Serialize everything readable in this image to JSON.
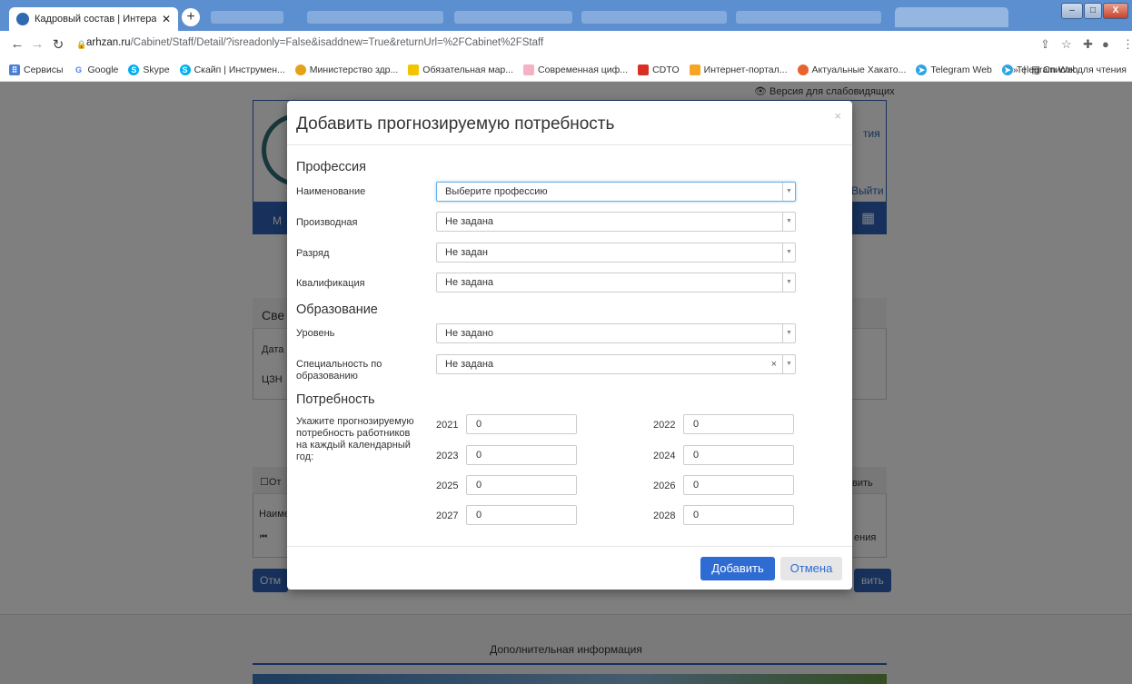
{
  "browser": {
    "active_tab": "Кадровый состав | Интерактив",
    "url_host": "arhzan.ru",
    "url_path": "/Cabinet/Staff/Detail/?isreadonly=False&isaddnew=True&returnUrl=%2FCabinet%2FStaff",
    "bookmarks": [
      "Сервисы",
      "Google",
      "Skype",
      "Скайп | Инструмен...",
      "Министерство здр...",
      "Обязательная мар...",
      "Современная циф...",
      "CDTO",
      "Интернет-портал...",
      "Актуальные Хакато...",
      "Telegram Web",
      "Telegram Web"
    ],
    "reading_list": "Список для чтения"
  },
  "page": {
    "accessibility": "Версия для слабовидящих",
    "frag_header_right": "тия",
    "frag_logout": "Выйти",
    "frag_nav_m": "М",
    "frag_sve": "Све",
    "frag_data": "Дата",
    "frag_czn": "ЦЗН",
    "frag_ot": "От",
    "frag_naim": "Наиме",
    "frag_btn1": "вить",
    "frag_btn2": "ения",
    "frag_otm": "Отм",
    "frag_btn3": "вить",
    "footer": "Дополнительная информация"
  },
  "modal": {
    "title": "Добавить прогнозируемую потребность",
    "close": "×",
    "profession": {
      "heading": "Профессия",
      "fields": [
        {
          "label": "Наименование",
          "value": "Выберите профессию"
        },
        {
          "label": "Производная",
          "value": "Не задана"
        },
        {
          "label": "Разряд",
          "value": "Не задан"
        },
        {
          "label": "Квалификация",
          "value": "Не задана"
        }
      ]
    },
    "education": {
      "heading": "Образование",
      "fields": [
        {
          "label": "Уровень",
          "value": "Не задано"
        },
        {
          "label": "Специальность по образованию",
          "value": "Не задана"
        }
      ]
    },
    "demand": {
      "heading": "Потребность",
      "hint": "Укажите прогнозируемую потребность работников на каждый календарный год:",
      "years": [
        {
          "year": "2021",
          "value": "0"
        },
        {
          "year": "2022",
          "value": "0"
        },
        {
          "year": "2023",
          "value": "0"
        },
        {
          "year": "2024",
          "value": "0"
        },
        {
          "year": "2025",
          "value": "0"
        },
        {
          "year": "2026",
          "value": "0"
        },
        {
          "year": "2027",
          "value": "0"
        },
        {
          "year": "2028",
          "value": "0"
        }
      ]
    },
    "add_button": "Добавить",
    "cancel_button": "Отмена"
  }
}
